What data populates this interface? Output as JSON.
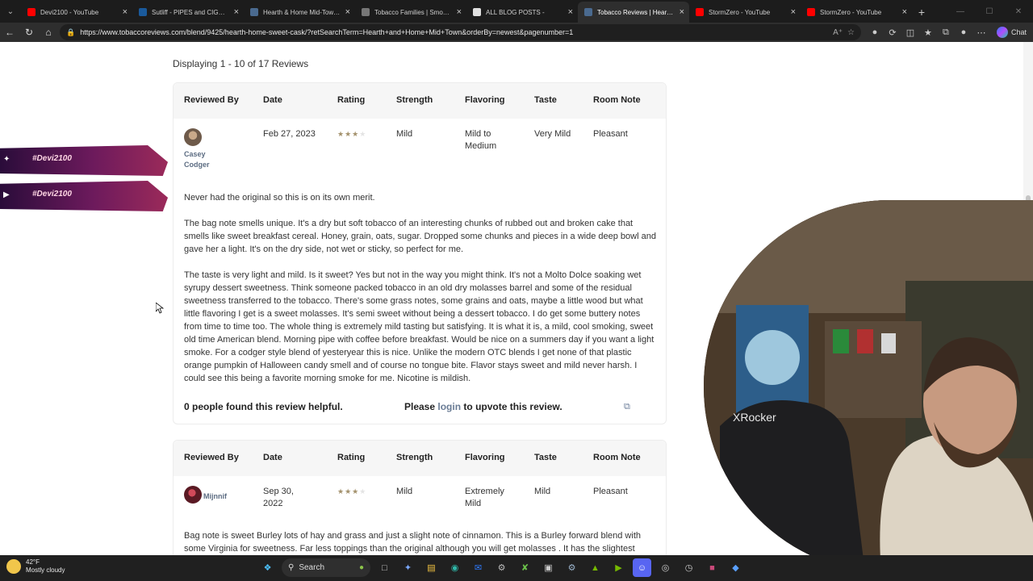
{
  "tabs": [
    {
      "title": "Devi2100 - YouTube",
      "color": "#ff0000",
      "active": false
    },
    {
      "title": "Sutliff - PIPES and CIGARS",
      "color": "#1a5a9c",
      "active": false
    },
    {
      "title": "Hearth & Home Mid-Town S",
      "color": "#4a6a8f",
      "active": false
    },
    {
      "title": "Tobacco Families | Smoking",
      "color": "#777777",
      "active": false
    },
    {
      "title": "ALL BLOG POSTS -",
      "color": "#e0e0e0",
      "active": false
    },
    {
      "title": "Tobacco Reviews | Hearth &",
      "color": "#4a6a8f",
      "active": true
    },
    {
      "title": "StormZero - YouTube",
      "color": "#ff0000",
      "active": false
    },
    {
      "title": "StormZero - YouTube",
      "color": "#ff0000",
      "active": false
    }
  ],
  "address": {
    "url": "https://www.tobaccoreviews.com/blend/9425/hearth-home-sweet-cask/?retSearchTerm=Hearth+and+Home+Mid+Town&orderBy=newest&pagenumber=1",
    "chat_label": "Chat"
  },
  "page": {
    "display_count": "Displaying 1 - 10 of 17 Reviews",
    "headers": {
      "reviewed_by": "Reviewed By",
      "date": "Date",
      "rating": "Rating",
      "strength": "Strength",
      "flavoring": "Flavoring",
      "taste": "Taste",
      "room_note": "Room Note"
    },
    "reviews": [
      {
        "reviewer_line1": "Casey",
        "reviewer_line2": "Codger",
        "date": "Feb 27, 2023",
        "rating": 3,
        "strength": "Mild",
        "flavoring_line1": "Mild to",
        "flavoring_line2": "Medium",
        "taste": "Very Mild",
        "room_note": "Pleasant",
        "paragraphs": [
          "Never had the original so this is on its own merit.",
          "The bag note smells unique. It's a dry but soft tobacco of an interesting chunks of rubbed out and broken cake that smells like sweet breakfast cereal. Honey, grain, oats, sugar. Dropped some chunks and pieces in a wide deep bowl and gave her a light. It's on the dry side, not wet or sticky, so perfect for me.",
          "The taste is very light and mild. Is it sweet? Yes but not in the way you might think. It's not a Molto Dolce soaking wet syrupy dessert sweetness. Think someone packed tobacco in an old dry molasses barrel and some of the residual sweetness transferred to the tobacco. There's some grass notes, some grains and oats, maybe a little wood but what little flavoring I get is a sweet molasses. It's semi sweet without being a dessert tobacco. I do get some buttery notes from time to time too. The whole thing is extremely mild tasting but satisfying. It is what it is, a mild, cool smoking, sweet old time American blend. Morning pipe with coffee before breakfast. Would be nice on a summers day if you want a light smoke. For a codger style blend of yesteryear this is nice. Unlike the modern OTC blends I get none of that plastic orange pumpkin of Halloween candy smell and of course no tongue bite. Flavor stays sweet and mild never harsh. I could see this being a favorite morning smoke for me. Nicotine is mildish."
        ],
        "helpful": "0 people found this review helpful.",
        "please": "Please",
        "login": "login",
        "upvote": "to upvote this review."
      },
      {
        "reviewer_line1": "Mijnnif",
        "date_line1": "Sep 30,",
        "date_line2": "2022",
        "rating": 3,
        "strength": "Mild",
        "flavoring_line1": "Extremely",
        "flavoring_line2": "Mild",
        "taste": "Mild",
        "room_note": "Pleasant",
        "paragraphs": [
          "Bag note is sweet Burley lots of hay and grass and just a slight note of cinnamon. This is a Burley forward blend with some Virginia for sweetness. Far less toppings than the original although you will get molasses . It has the slightest"
        ]
      }
    ]
  },
  "overlay": {
    "handle1": "#Devi2100",
    "handle2": "#Devi2100",
    "chair_brand": "XRocker"
  },
  "taskbar": {
    "temp": "42°F",
    "condition": "Mostly cloudy",
    "search": "Search"
  }
}
